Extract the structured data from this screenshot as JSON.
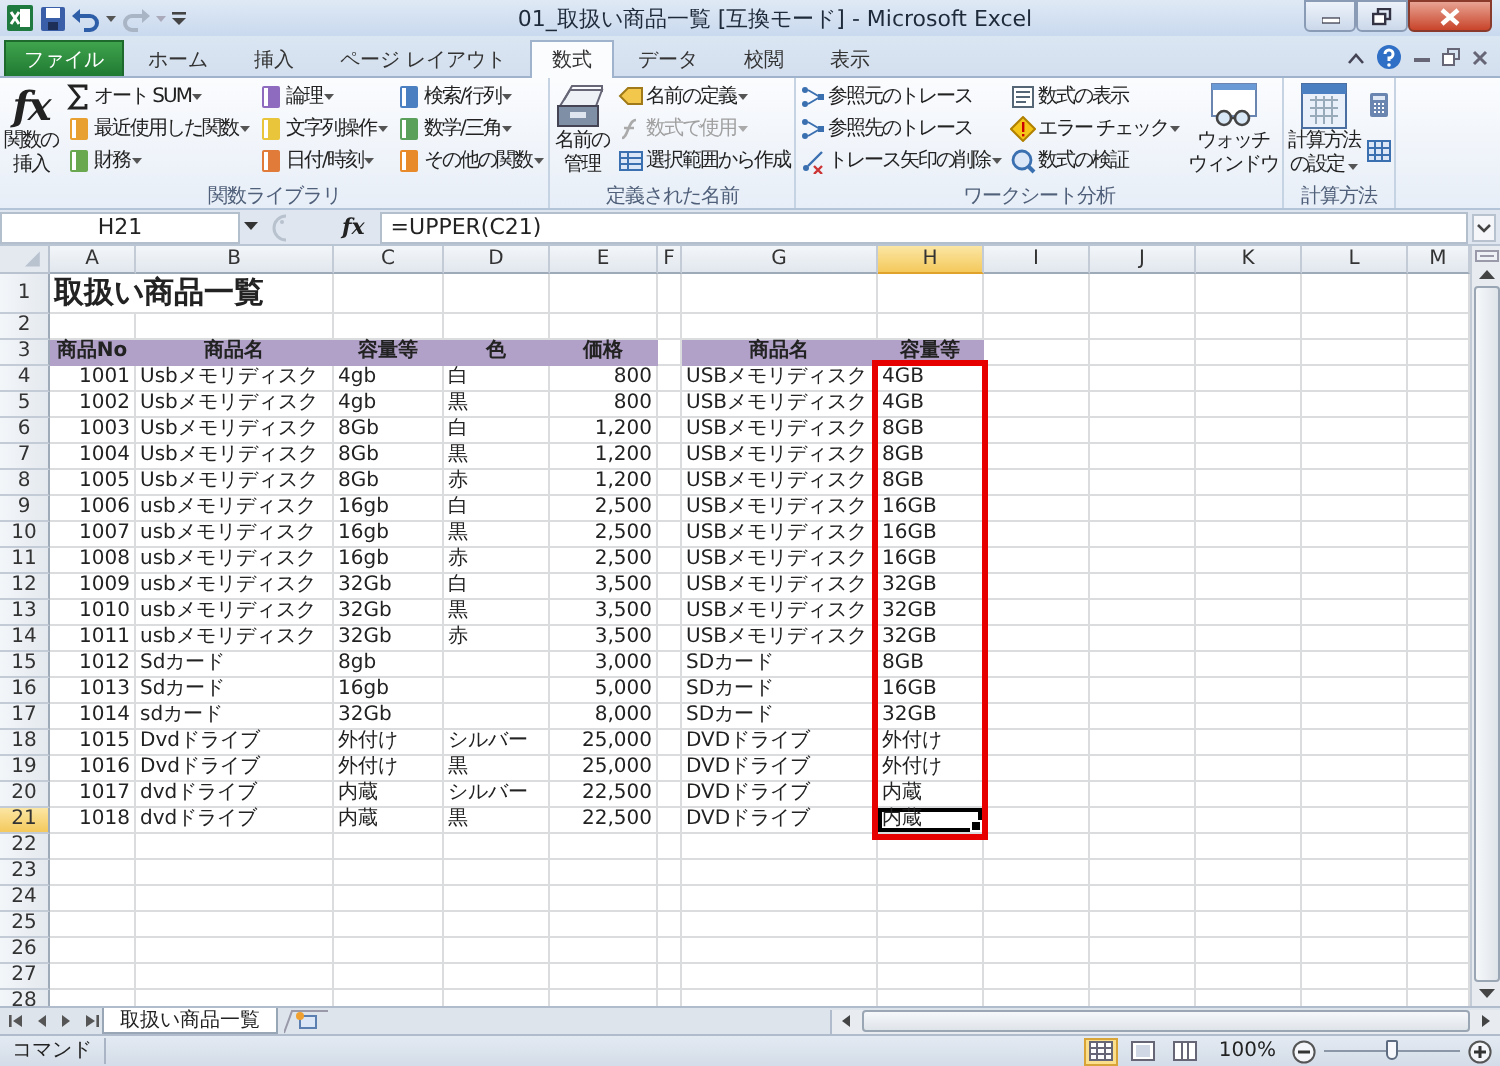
{
  "window": {
    "title": "01_取扱い商品一覧 [互換モード] - Microsoft Excel"
  },
  "ribbon_tabs": [
    {
      "label": "ファイル",
      "kind": "file",
      "selected": false
    },
    {
      "label": "ホーム",
      "kind": "tab",
      "selected": false
    },
    {
      "label": "挿入",
      "kind": "tab",
      "selected": false
    },
    {
      "label": "ページ レイアウト",
      "kind": "tab",
      "selected": false
    },
    {
      "label": "数式",
      "kind": "tab",
      "selected": true
    },
    {
      "label": "データ",
      "kind": "tab",
      "selected": false
    },
    {
      "label": "校閲",
      "kind": "tab",
      "selected": false
    },
    {
      "label": "表示",
      "kind": "tab",
      "selected": false
    }
  ],
  "ribbon_groups": [
    {
      "label": "関数ライブラリ",
      "items": [
        {
          "kind": "large",
          "glyph": "fx",
          "lines": [
            "関数の",
            "挿入"
          ],
          "dropdown": false
        },
        {
          "kind": "column",
          "entries": [
            {
              "label": "オート SUM",
              "dropdown": true,
              "disabled": false
            },
            {
              "label": "最近使用した関数",
              "dropdown": true,
              "disabled": false
            },
            {
              "label": "財務",
              "dropdown": true,
              "disabled": false
            }
          ]
        },
        {
          "kind": "column",
          "entries": [
            {
              "label": "論理",
              "dropdown": true,
              "disabled": false
            },
            {
              "label": "文字列操作",
              "dropdown": true,
              "disabled": false
            },
            {
              "label": "日付/時刻",
              "dropdown": true,
              "disabled": false
            }
          ]
        },
        {
          "kind": "column",
          "entries": [
            {
              "label": "検索/行列",
              "dropdown": true,
              "disabled": false
            },
            {
              "label": "数学/三角",
              "dropdown": true,
              "disabled": false
            },
            {
              "label": "その他の関数",
              "dropdown": true,
              "disabled": false
            }
          ]
        }
      ]
    },
    {
      "label": "定義された名前",
      "items": [
        {
          "kind": "large",
          "lines": [
            "名前の",
            "管理"
          ],
          "dropdown": false
        },
        {
          "kind": "column",
          "entries": [
            {
              "label": "名前の定義",
              "dropdown": true,
              "disabled": false
            },
            {
              "label": "数式で使用",
              "dropdown": true,
              "disabled": true
            },
            {
              "label": "選択範囲から作成",
              "dropdown": false,
              "disabled": false
            }
          ]
        }
      ]
    },
    {
      "label": "ワークシート分析",
      "items": [
        {
          "kind": "column",
          "entries": [
            {
              "label": "参照元のトレース",
              "dropdown": false,
              "disabled": false
            },
            {
              "label": "参照先のトレース",
              "dropdown": false,
              "disabled": false
            },
            {
              "label": "トレース矢印の削除",
              "dropdown": true,
              "disabled": false
            }
          ]
        },
        {
          "kind": "column",
          "entries": [
            {
              "label": "数式の表示",
              "dropdown": false,
              "disabled": false
            },
            {
              "label": "エラー チェック",
              "dropdown": true,
              "disabled": false
            },
            {
              "label": "数式の検証",
              "dropdown": false,
              "disabled": false
            }
          ]
        },
        {
          "kind": "large",
          "lines": [
            "ウォッチ",
            "ウィンドウ"
          ],
          "dropdown": false
        }
      ]
    },
    {
      "label": "計算方法",
      "items": [
        {
          "kind": "large",
          "lines": [
            "計算方法",
            "の設定"
          ],
          "dropdown": true
        },
        {
          "kind": "icon-column"
        }
      ]
    }
  ],
  "formula_bar": {
    "name_box": "H21",
    "fx": "fx",
    "formula": "=UPPER(C21)"
  },
  "sheet": {
    "columns": [
      {
        "label": "A",
        "kind": "number",
        "selected": false,
        "framed": false
      },
      {
        "label": "B",
        "kind": "text",
        "selected": false,
        "framed": false
      },
      {
        "label": "C",
        "kind": "text",
        "selected": false,
        "framed": false
      },
      {
        "label": "D",
        "kind": "text",
        "selected": false,
        "framed": false
      },
      {
        "label": "E",
        "kind": "number",
        "selected": false,
        "framed": false
      },
      {
        "label": "F",
        "kind": "text",
        "selected": false,
        "framed": false
      },
      {
        "label": "G",
        "kind": "text",
        "selected": false,
        "framed": false
      },
      {
        "label": "H",
        "kind": "text",
        "selected": true,
        "framed": true
      },
      {
        "label": "I",
        "kind": "text",
        "selected": false,
        "framed": false
      },
      {
        "label": "J",
        "kind": "text",
        "selected": false,
        "framed": false
      },
      {
        "label": "K",
        "kind": "text",
        "selected": false,
        "framed": false
      },
      {
        "label": "L",
        "kind": "text",
        "selected": false,
        "framed": false
      },
      {
        "label": "M",
        "kind": "text",
        "selected": false,
        "framed": false
      }
    ],
    "rows": [
      {
        "label": "1",
        "kind": "title",
        "selected": false,
        "cells": [
          "取扱い商品一覧"
        ]
      },
      {
        "label": "2",
        "kind": "data",
        "selected": false
      },
      {
        "label": "3",
        "kind": "header",
        "selected": false,
        "cells": [
          "商品No",
          "商品名",
          "容量等",
          "色",
          "価格",
          null,
          "商品名",
          "容量等"
        ]
      },
      {
        "label": "4",
        "kind": "data",
        "selected": false,
        "cells": [
          "1001",
          "Usbメモリディスク",
          "4gb",
          "白",
          "800",
          null,
          "USBメモリディスク",
          "4GB"
        ]
      },
      {
        "label": "5",
        "kind": "data",
        "selected": false,
        "cells": [
          "1002",
          "Usbメモリディスク",
          "4gb",
          "黒",
          "800",
          null,
          "USBメモリディスク",
          "4GB"
        ]
      },
      {
        "label": "6",
        "kind": "data",
        "selected": false,
        "cells": [
          "1003",
          "Usbメモリディスク",
          "8Gb",
          "白",
          "1,200",
          null,
          "USBメモリディスク",
          "8GB"
        ]
      },
      {
        "label": "7",
        "kind": "data",
        "selected": false,
        "cells": [
          "1004",
          "Usbメモリディスク",
          "8Gb",
          "黒",
          "1,200",
          null,
          "USBメモリディスク",
          "8GB"
        ]
      },
      {
        "label": "8",
        "kind": "data",
        "selected": false,
        "cells": [
          "1005",
          "Usbメモリディスク",
          "8Gb",
          "赤",
          "1,200",
          null,
          "USBメモリディスク",
          "8GB"
        ]
      },
      {
        "label": "9",
        "kind": "data",
        "selected": false,
        "cells": [
          "1006",
          "usbメモリディスク",
          "16gb",
          "白",
          "2,500",
          null,
          "USBメモリディスク",
          "16GB"
        ]
      },
      {
        "label": "10",
        "kind": "data",
        "selected": false,
        "cells": [
          "1007",
          "usbメモリディスク",
          "16gb",
          "黒",
          "2,500",
          null,
          "USBメモリディスク",
          "16GB"
        ]
      },
      {
        "label": "11",
        "kind": "data",
        "selected": false,
        "cells": [
          "1008",
          "usbメモリディスク",
          "16gb",
          "赤",
          "2,500",
          null,
          "USBメモリディスク",
          "16GB"
        ]
      },
      {
        "label": "12",
        "kind": "data",
        "selected": false,
        "cells": [
          "1009",
          "usbメモリディスク",
          "32Gb",
          "白",
          "3,500",
          null,
          "USBメモリディスク",
          "32GB"
        ]
      },
      {
        "label": "13",
        "kind": "data",
        "selected": false,
        "cells": [
          "1010",
          "usbメモリディスク",
          "32Gb",
          "黒",
          "3,500",
          null,
          "USBメモリディスク",
          "32GB"
        ]
      },
      {
        "label": "14",
        "kind": "data",
        "selected": false,
        "cells": [
          "1011",
          "usbメモリディスク",
          "32Gb",
          "赤",
          "3,500",
          null,
          "USBメモリディスク",
          "32GB"
        ]
      },
      {
        "label": "15",
        "kind": "data",
        "selected": false,
        "cells": [
          "1012",
          "Sdカード",
          "8gb",
          null,
          "3,000",
          null,
          "SDカード",
          "8GB"
        ]
      },
      {
        "label": "16",
        "kind": "data",
        "selected": false,
        "cells": [
          "1013",
          "Sdカード",
          "16gb",
          null,
          "5,000",
          null,
          "SDカード",
          "16GB"
        ]
      },
      {
        "label": "17",
        "kind": "data",
        "selected": false,
        "cells": [
          "1014",
          "sdカード",
          "32Gb",
          null,
          "8,000",
          null,
          "SDカード",
          "32GB"
        ]
      },
      {
        "label": "18",
        "kind": "data",
        "selected": false,
        "cells": [
          "1015",
          "Dvdドライブ",
          "外付け",
          "シルバー",
          "25,000",
          null,
          "DVDドライブ",
          "外付け"
        ]
      },
      {
        "label": "19",
        "kind": "data",
        "selected": false,
        "cells": [
          "1016",
          "Dvdドライブ",
          "外付け",
          "黒",
          "25,000",
          null,
          "DVDドライブ",
          "外付け"
        ]
      },
      {
        "label": "20",
        "kind": "data",
        "selected": false,
        "cells": [
          "1017",
          "dvdドライブ",
          "内蔵",
          "シルバー",
          "22,500",
          null,
          "DVDドライブ",
          "内蔵"
        ]
      },
      {
        "label": "21",
        "kind": "data",
        "selected": true,
        "cells": [
          "1018",
          "dvdドライブ",
          "内蔵",
          "黒",
          "22,500",
          null,
          "DVDドライブ",
          "内蔵"
        ]
      },
      {
        "label": "22",
        "kind": "data",
        "selected": false
      },
      {
        "label": "23",
        "kind": "data",
        "selected": false
      },
      {
        "label": "24",
        "kind": "data",
        "selected": false
      },
      {
        "label": "25",
        "kind": "data",
        "selected": false
      },
      {
        "label": "26",
        "kind": "data",
        "selected": false
      },
      {
        "label": "27",
        "kind": "data",
        "selected": false
      },
      {
        "label": "28",
        "kind": "data",
        "selected": false
      }
    ]
  },
  "sheet_tabs": [
    {
      "label": "取扱い商品一覧",
      "selected": true
    }
  ],
  "status_bar": {
    "mode": "コマンド",
    "views": [
      {
        "kind": "normal",
        "selected": true
      },
      {
        "kind": "page-layout",
        "selected": false
      },
      {
        "kind": "page-break",
        "selected": false
      }
    ],
    "zoom": "100%",
    "zoom_slider": {
      "level": 0.5
    }
  }
}
